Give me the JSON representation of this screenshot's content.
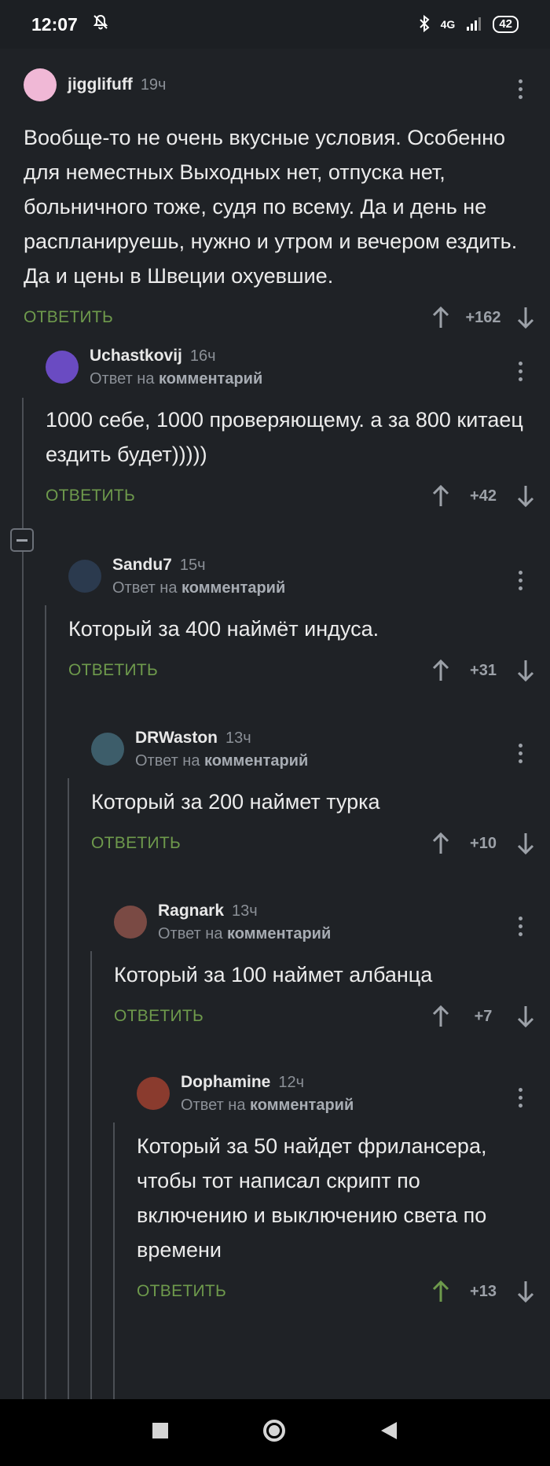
{
  "status_bar": {
    "time": "12:07",
    "network": "4G",
    "battery": "42"
  },
  "thread": {
    "reply_label": "ОТВЕТИТЬ",
    "reply_to_prefix": "Ответ на",
    "reply_to_target": "комментарий",
    "comments": [
      {
        "username": "jigglifuff",
        "time": "19ч",
        "text": "Вообще-то не очень вкусные условия. Особенно для неместных  Выходных нет, отпуска нет, больничного тоже, судя по всему. Да и день не распланируешь, нужно и утром и вечером ездить.  Да и цены в Швеции охуевшие.",
        "score": "+162",
        "avatar_color": "#f0b8d6"
      },
      {
        "username": "Uchastkovij",
        "time": "16ч",
        "text": "1000  себе, 1000 проверяющему. а за 800 китаец ездить будет)))))",
        "score": "+42",
        "avatar_color": "#6a4bc2"
      },
      {
        "username": "Sandu7",
        "time": "15ч",
        "text": "Который за 400 наймёт индуса.",
        "score": "+31",
        "avatar_color": "#2b3a4e"
      },
      {
        "username": "DRWaston",
        "time": "13ч",
        "text": "Который за 200 наймет турка",
        "score": "+10",
        "avatar_color": "#3d5d6a"
      },
      {
        "username": "Ragnark",
        "time": "13ч",
        "text": "Который за 100 наймет албанца",
        "score": "+7",
        "avatar_color": "#7a4a44"
      },
      {
        "username": "Dophamine",
        "time": "12ч",
        "text": "Который за 50 найдет фрилансера, чтобы тот написал скрипт по включению и выключению света по времени",
        "score": "+13",
        "avatar_color": "#8a3b2e",
        "upvoted": true
      }
    ]
  },
  "colors": {
    "background": "#1f2226",
    "reply_green": "#6e9a4c",
    "upvote_active": "#6e9a4c",
    "thread_line": "#4b4f55"
  },
  "icons": [
    "muted-bell-icon",
    "bluetooth-icon",
    "signal-icon",
    "more-icon",
    "upvote-arrow-icon",
    "downvote-arrow-icon",
    "collapse-icon",
    "nav-square-icon",
    "nav-circle-icon",
    "nav-back-icon"
  ]
}
